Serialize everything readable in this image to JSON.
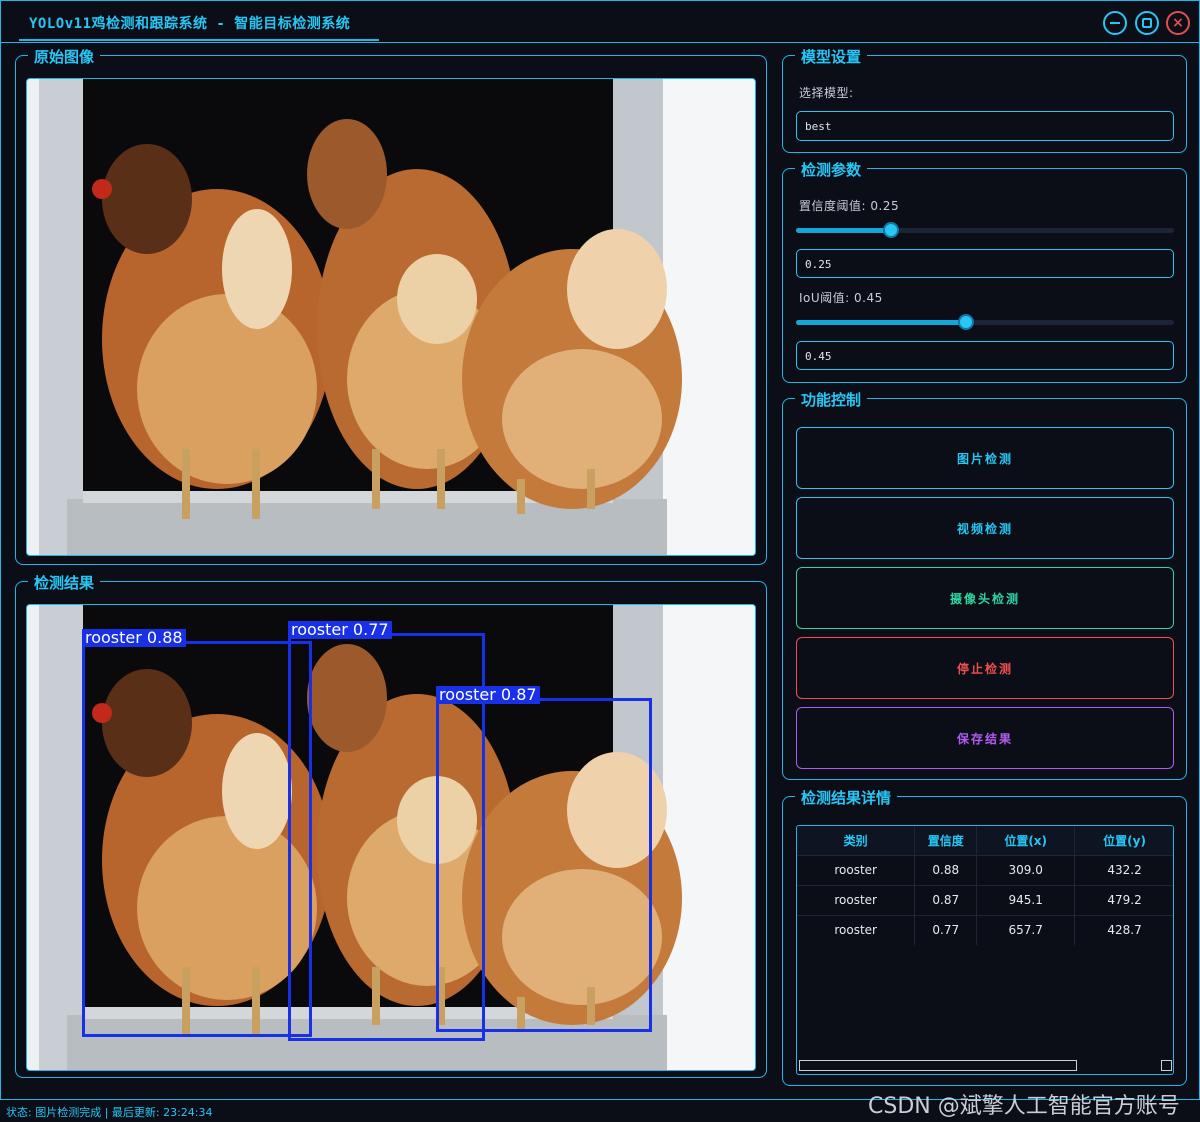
{
  "window": {
    "title": "YOLOv11鸡检测和跟踪系统 - 智能目标检测系统"
  },
  "original_panel": {
    "title": "原始图像"
  },
  "result_panel": {
    "title": "检测结果",
    "detections": [
      {
        "label": "rooster 0.88"
      },
      {
        "label": "rooster 0.77"
      },
      {
        "label": "rooster 0.87"
      }
    ]
  },
  "model_settings": {
    "title": "模型设置",
    "select_label": "选择模型:",
    "model_value": "best"
  },
  "detect_params": {
    "title": "检测参数",
    "conf_label": "置信度阈值: 0.25",
    "conf_value": "0.25",
    "conf_level": 0.25,
    "iou_label": "IoU阈值: 0.45",
    "iou_value": "0.45",
    "iou_level": 0.45
  },
  "function_control": {
    "title": "功能控制",
    "buttons": [
      {
        "label": "图片检测",
        "color": "#27c6f5"
      },
      {
        "label": "视频检测",
        "color": "#27c6f5"
      },
      {
        "label": "摄像头检测",
        "color": "#2fd4a0"
      },
      {
        "label": "停止检测",
        "color": "#ef4f4f"
      },
      {
        "label": "保存结果",
        "color": "#b05cf0"
      }
    ]
  },
  "result_details": {
    "title": "检测结果详情",
    "columns": [
      "类别",
      "置信度",
      "位置(x)",
      "位置(y)"
    ],
    "rows": [
      [
        "rooster",
        "0.88",
        "309.0",
        "432.2"
      ],
      [
        "rooster",
        "0.87",
        "945.1",
        "479.2"
      ],
      [
        "rooster",
        "0.77",
        "657.7",
        "428.7"
      ]
    ]
  },
  "status": {
    "text": "状态: 图片检测完成 | 最后更新: 23:24:34"
  },
  "watermark": "CSDN @斌擎人工智能官方账号"
}
